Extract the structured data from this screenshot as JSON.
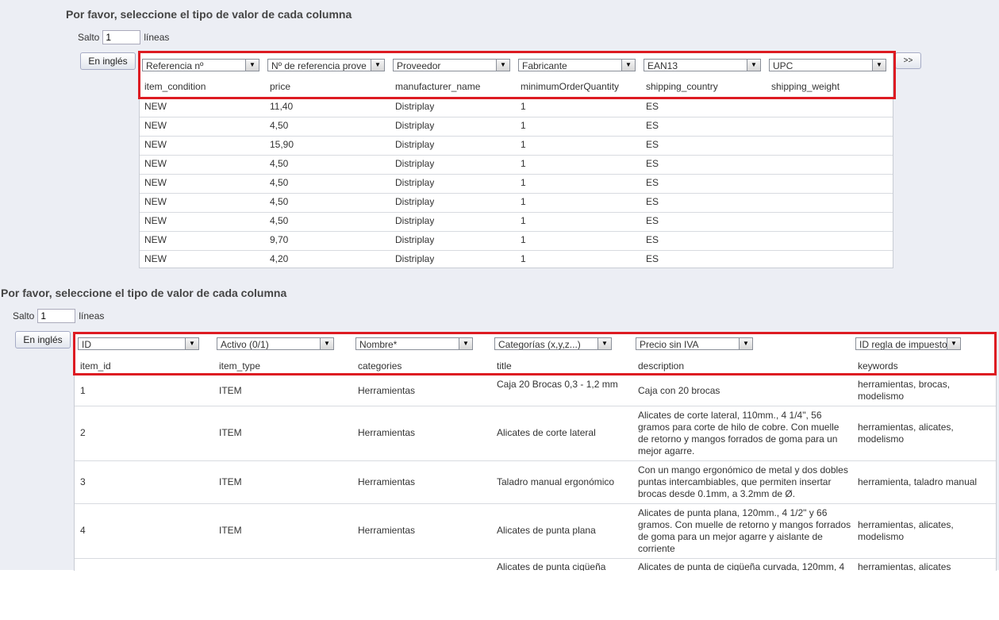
{
  "accent_color": "#dd1b22",
  "section1": {
    "heading": "Por favor, seleccione el tipo de valor de cada columna",
    "salto_label": "Salto",
    "salto_value": "1",
    "lineas_label": "líneas",
    "lang_button": "En inglés",
    "next_button": ">>",
    "selects": [
      "Referencia nº",
      "Nº de referencia prove",
      "Proveedor",
      "Fabricante",
      "EAN13",
      "UPC"
    ],
    "headers": [
      "item_condition",
      "price",
      "manufacturer_name",
      "minimumOrderQuantity",
      "shipping_country",
      "shipping_weight"
    ],
    "rows": [
      [
        "NEW",
        "11,40",
        "Distriplay",
        "1",
        "ES",
        ""
      ],
      [
        "NEW",
        "4,50",
        "Distriplay",
        "1",
        "ES",
        ""
      ],
      [
        "NEW",
        "15,90",
        "Distriplay",
        "1",
        "ES",
        ""
      ],
      [
        "NEW",
        "4,50",
        "Distriplay",
        "1",
        "ES",
        ""
      ],
      [
        "NEW",
        "4,50",
        "Distriplay",
        "1",
        "ES",
        ""
      ],
      [
        "NEW",
        "4,50",
        "Distriplay",
        "1",
        "ES",
        ""
      ],
      [
        "NEW",
        "4,50",
        "Distriplay",
        "1",
        "ES",
        ""
      ],
      [
        "NEW",
        "9,70",
        "Distriplay",
        "1",
        "ES",
        ""
      ],
      [
        "NEW",
        "4,20",
        "Distriplay",
        "1",
        "ES",
        ""
      ]
    ]
  },
  "section2": {
    "heading": "Por favor, seleccione el tipo de valor de cada columna",
    "salto_label": "Salto",
    "salto_value": "1",
    "lineas_label": "líneas",
    "lang_button": "En inglés",
    "selects": [
      "ID",
      "Activo (0/1)",
      "Nombre*",
      "Categorías (x,y,z...)",
      "Precio sin IVA",
      "ID regla de impuestos"
    ],
    "headers": [
      "item_id",
      "item_type",
      "categories",
      "title",
      "description",
      "keywords"
    ],
    "rows": [
      [
        "1",
        "ITEM",
        "Herramientas",
        "Caja 20 Brocas 0,3 - 1,2 mm",
        "Caja con 20 brocas",
        "herramientas, brocas, modelismo"
      ],
      [
        "2",
        "ITEM",
        "Herramientas",
        "Alicates de corte lateral",
        "Alicates de corte lateral, 110mm., 4 1/4\", 56 gramos para corte de hilo de cobre. Con muelle de retorno y mangos forrados de goma para un mejor agarre.",
        "herramientas, alicates, modelismo"
      ],
      [
        "3",
        "ITEM",
        "Herramientas",
        "Taladro manual ergonómico",
        "Con un mango ergonómico de metal y dos dobles puntas intercambiables, que permiten insertar brocas desde 0.1mm, a 3.2mm de Ø.",
        "herramienta, taladro manual"
      ],
      [
        "4",
        "ITEM",
        "Herramientas",
        "Alicates de punta plana",
        "Alicates de punta plana, 120mm., 4 1/2\" y 66 gramos. Con muelle de retorno y mangos forrados de goma para un mejor agarre y aislante de corriente",
        "herramientas, alicates, modelismo"
      ],
      [
        "",
        "",
        "",
        "Alicates de punta cigüeña",
        "Alicates de punta de cigüeña curvada, 120mm, 4",
        "herramientas, alicates"
      ]
    ]
  }
}
